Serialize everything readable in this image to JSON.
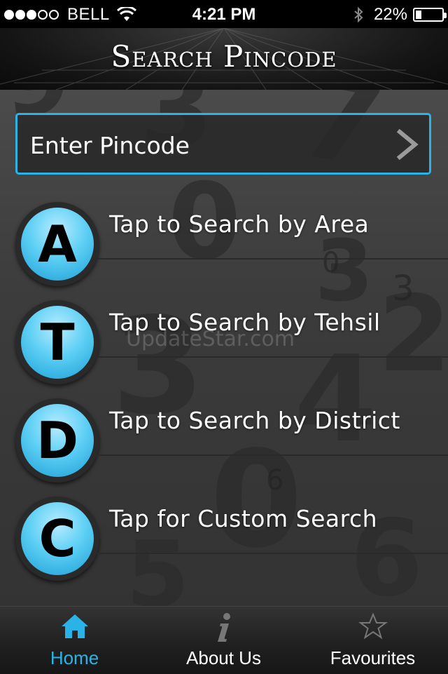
{
  "status_bar": {
    "carrier": "BELL",
    "time": "4:21 PM",
    "battery_percent": "22%",
    "battery_level": 0.22,
    "signal_bars_full": 3,
    "signal_bars_total": 5
  },
  "header": {
    "title": "Search Pincode"
  },
  "pincode": {
    "placeholder": "Enter Pincode"
  },
  "options": [
    {
      "letter": "A",
      "label": "Tap to Search by Area"
    },
    {
      "letter": "T",
      "label": "Tap to Search by Tehsil"
    },
    {
      "letter": "D",
      "label": "Tap to Search by District"
    },
    {
      "letter": "C",
      "label": "Tap for Custom Search"
    }
  ],
  "watermark": "UpdateStar.com",
  "tabs": [
    {
      "label": "Home",
      "icon": "home-icon",
      "active": true
    },
    {
      "label": "About Us",
      "icon": "info-icon",
      "active": false
    },
    {
      "label": "Favourites",
      "icon": "star-icon",
      "active": false
    }
  ],
  "colors": {
    "accent": "#29b3e6",
    "badge": "#5fd0f5"
  }
}
